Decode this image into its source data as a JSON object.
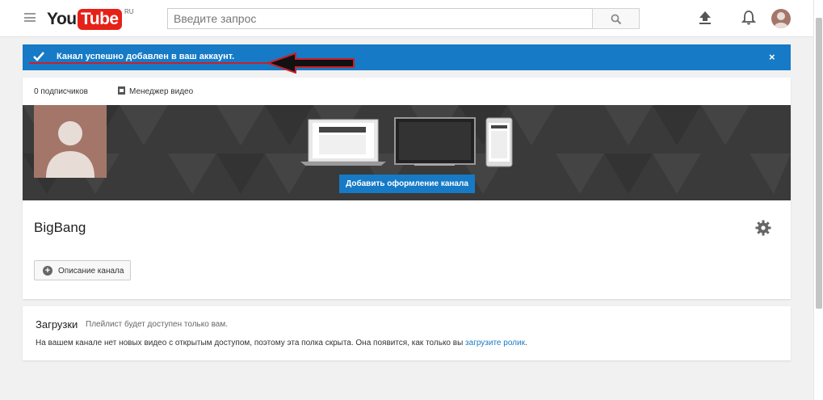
{
  "header": {
    "logo_you": "You",
    "logo_tube": "Tube",
    "logo_region": "RU",
    "search_placeholder": "Введите запрос",
    "icons": [
      "menu-icon",
      "search-icon",
      "upload-icon",
      "bell-icon",
      "avatar"
    ]
  },
  "alert": {
    "message": "Канал успешно добавлен в ваш аккаунт.",
    "close": "×",
    "color": "#167ac6"
  },
  "channel": {
    "subscribers": "0 подписчиков",
    "video_manager": "Менеджер видео",
    "add_art_button": "Добавить оформление канала",
    "name": "BigBang",
    "description_button": "Описание канала"
  },
  "uploads": {
    "title": "Загрузки",
    "subtitle": "Плейлист будет доступен только вам.",
    "message": "На вашем канале нет новых видео с открытым доступом, поэтому эта полка скрыта. Она появится, как только вы ",
    "link": "загрузите ролик",
    "message_end": "."
  },
  "colors": {
    "accent": "#167ac6",
    "logo_red": "#e62117",
    "avatar_bg": "#a4766a"
  }
}
